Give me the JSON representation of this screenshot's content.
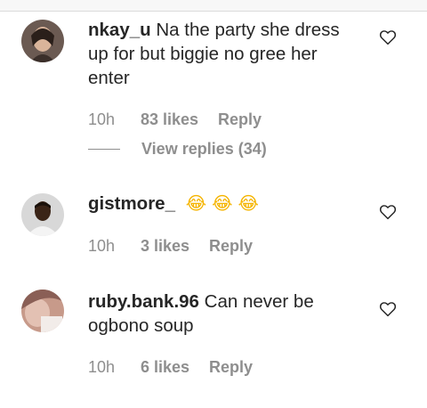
{
  "comments": [
    {
      "username": "nkay_u",
      "text": "Na the party she dress up for but biggie no gree her enter",
      "time": "10h",
      "likes": "83 likes",
      "reply": "Reply",
      "view_replies": "View replies (34)",
      "avatar": "avatar-photo-woman",
      "like_icon": "heart-outline-icon"
    },
    {
      "username": "gistmore_",
      "text": "",
      "emoji": [
        "😂",
        "😂",
        "😂"
      ],
      "time": "10h",
      "likes": "3 likes",
      "reply": "Reply",
      "avatar": "avatar-photo-man",
      "like_icon": "heart-outline-icon"
    },
    {
      "username": "ruby.bank.96",
      "text": "Can never be ogbono soup",
      "time": "10h",
      "likes": "6 likes",
      "reply": "Reply",
      "avatar": "avatar-photo-woman",
      "like_icon": "heart-outline-icon"
    }
  ],
  "colors": {
    "text": "#262626",
    "secondary": "#8e8e8e",
    "emoji": "#f5b400"
  }
}
